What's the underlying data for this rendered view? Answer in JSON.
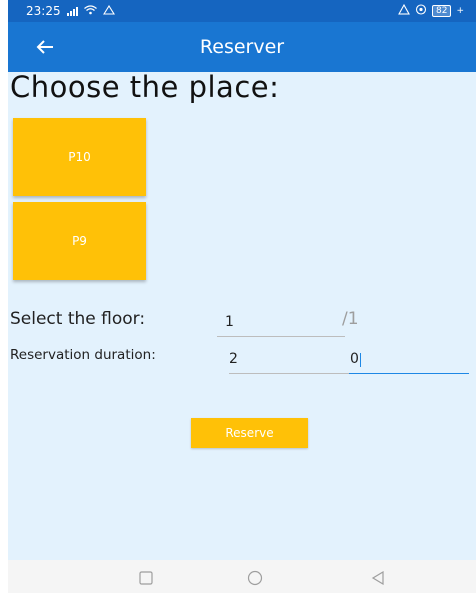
{
  "status_bar": {
    "time": "23:25",
    "battery": "82",
    "icons": [
      "signal-icon",
      "wifi-icon",
      "data-icon",
      "alarm-icon",
      "battery-icon"
    ]
  },
  "app_bar": {
    "title": "Reserver",
    "back_icon": "arrow-left-icon"
  },
  "main": {
    "heading": "Choose the place:",
    "places": [
      {
        "label": "P10"
      },
      {
        "label": "P9"
      }
    ],
    "floor": {
      "label": "Select the floor:",
      "value": "1",
      "suffix": "/1"
    },
    "duration": {
      "label": "Reservation duration:",
      "value": "2",
      "second_value": "0"
    },
    "reserve_label": "Reserve"
  },
  "nav_bar": {
    "icons": [
      "recent-apps-icon",
      "home-icon",
      "back-icon"
    ]
  },
  "colors": {
    "primary": "#1976d2",
    "status": "#1565c0",
    "accent": "#ffc107",
    "background": "#e3f2fd"
  }
}
